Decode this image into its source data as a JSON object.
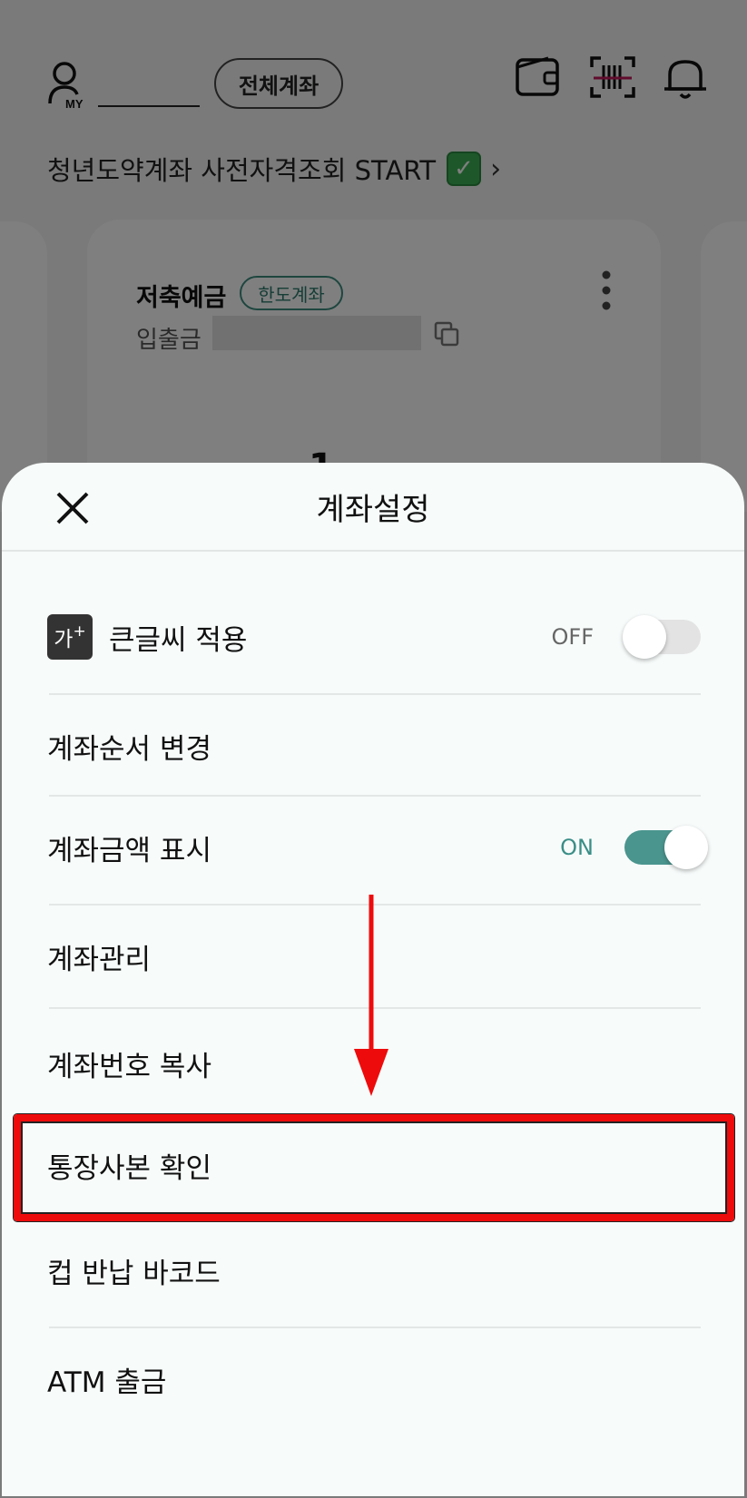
{
  "header": {
    "my_icon_label": "MY",
    "all_accounts_label": "전체계좌",
    "icons": [
      "my-icon",
      "wallet-icon",
      "barcode-scan-icon",
      "bell-icon"
    ]
  },
  "promo_banner": {
    "text": "청년도약계좌 사전자격조회 START",
    "check_glyph": "✓",
    "chevron": "›"
  },
  "account_card": {
    "name": "저축예금",
    "badge": "한도계좌",
    "type": "입출금",
    "balance_partial": "1"
  },
  "sheet": {
    "close_glyph": "✕",
    "title": "계좌설정",
    "big_font_icon_text": "가",
    "big_font_icon_sup": "+",
    "items": [
      {
        "label": "큰글씨 적용",
        "toggle": "OFF"
      },
      {
        "label": "계좌순서 변경"
      },
      {
        "label": "계좌금액 표시",
        "toggle": "ON"
      },
      {
        "label": "계좌관리"
      },
      {
        "label": "계좌번호 복사"
      },
      {
        "label": "통장사본 확인",
        "highlighted": true
      },
      {
        "label": "컵 반납 바코드"
      },
      {
        "label": "ATM 출금"
      }
    ]
  },
  "annotation": {
    "arrow_color": "#ee0b0b",
    "box_color": "#ee0b0b"
  },
  "colors": {
    "accent_teal": "#4a958e",
    "badge_green": "#2c7a6c",
    "dim_overlay": "rgba(0,0,0,0.5)"
  }
}
